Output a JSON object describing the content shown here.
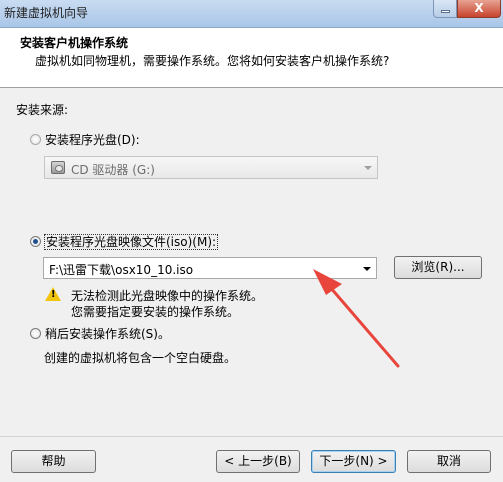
{
  "window": {
    "title": "新建虚拟机向导",
    "close_glyph": "X"
  },
  "header": {
    "title": "安装客户机操作系统",
    "subtitle": "虚拟机如同物理机，需要操作系统。您将如何安装客户机操作系统?"
  },
  "install_source": {
    "label": "安装来源:",
    "disc_option": {
      "label": "安装程序光盘(D):",
      "checked": false,
      "combo_value": "CD 驱动器 (G:)"
    },
    "iso_option": {
      "label": "安装程序光盘映像文件(iso)(M):",
      "checked": true,
      "combo_value": "F:\\迅雷下载\\osx10_10.iso",
      "browse_label": "浏览(R)...",
      "warning_line1": "无法检测此光盘映像中的操作系统。",
      "warning_line2": "您需要指定要安装的操作系统。"
    },
    "later_option": {
      "label": "稍后安装操作系统(S)。",
      "checked": false,
      "description": "创建的虚拟机将包含一个空白硬盘。"
    }
  },
  "footer": {
    "help_label": "帮助",
    "back_label": "< 上一步(B)",
    "next_label": "下一步(N) >",
    "cancel_label": "取消"
  },
  "colors": {
    "annotation_arrow": "#e8453c"
  }
}
